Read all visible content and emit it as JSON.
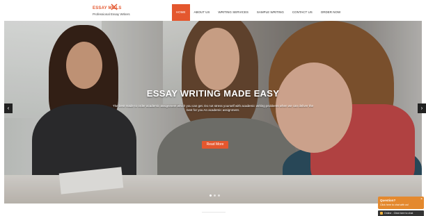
{
  "brand": {
    "name": "ESSAY MILLS",
    "tagline": "Professional Essay Writers",
    "icon": "crossed-pens-icon",
    "accent_color": "#e4572e"
  },
  "nav": {
    "items": [
      {
        "label": "HOME",
        "active": true
      },
      {
        "label": "ABOUT US",
        "active": false
      },
      {
        "label": "WRITING SERVICES",
        "active": false
      },
      {
        "label": "SAMPLE WRITING",
        "active": false
      },
      {
        "label": "CONTACT US",
        "active": false
      },
      {
        "label": "ORDER NOW",
        "active": false
      }
    ]
  },
  "hero": {
    "title": "ESSAY WRITING MADE EASY",
    "text": "The best made to order academic assignment which you can get. Do not stress yourself with academic writing problems when we can deliver the best for you An academic assignment.",
    "button_label": "Read More",
    "prev_icon": "chevron-left-icon",
    "next_icon": "chevron-right-icon",
    "prev_glyph": "‹",
    "next_glyph": "›",
    "slide_count": 3,
    "active_slide": 1
  },
  "chat": {
    "title": "Question?",
    "subtitle": "Click here to chat with us!",
    "close_glyph": "×",
    "status_text": "Online - Click here to chat",
    "color": "#e4892e"
  }
}
